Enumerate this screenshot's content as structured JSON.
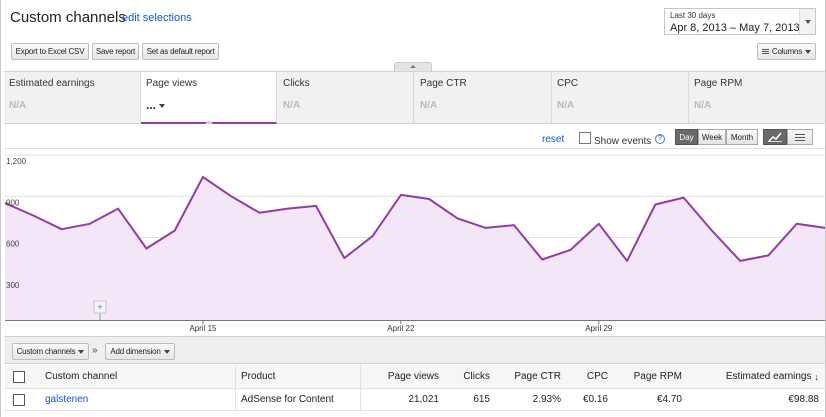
{
  "header": {
    "title": "Custom channels",
    "edit_link": "edit selections",
    "date_range": {
      "label": "Last 30 days",
      "range": "Apr 8, 2013 – May 7, 2013"
    }
  },
  "toolbar": {
    "export_label": "Export to Excel CSV",
    "save_label": "Save report",
    "default_label": "Set as default report",
    "columns_label": "Columns"
  },
  "metrics": [
    {
      "label": "Estimated earnings",
      "value": "N/A"
    },
    {
      "label": "Page views",
      "value": "...",
      "selected": true
    },
    {
      "label": "Clicks",
      "value": "N/A"
    },
    {
      "label": "Page CTR",
      "value": "N/A"
    },
    {
      "label": "CPC",
      "value": "N/A"
    },
    {
      "label": "Page RPM",
      "value": "N/A"
    }
  ],
  "chart_controls": {
    "reset_label": "reset",
    "show_events_label": "Show events",
    "help_icon": "?",
    "granularity": [
      "Day",
      "Week",
      "Month"
    ],
    "active_granularity": "Day",
    "view_icons": [
      "line-chart-icon",
      "table-view-icon"
    ]
  },
  "chart_data": {
    "type": "area",
    "ylim": [
      0,
      1200
    ],
    "yticks": [
      {
        "value": 1200,
        "label": "1,200"
      },
      {
        "value": 900,
        "label": "900"
      },
      {
        "value": 600,
        "label": "600"
      },
      {
        "value": 300,
        "label": "300"
      }
    ],
    "x_labels": [
      {
        "index": 7,
        "label": "April 15"
      },
      {
        "index": 14,
        "label": "April 22"
      },
      {
        "index": 21,
        "label": "April 29"
      }
    ],
    "x_dates": [
      "Apr 8",
      "Apr 9",
      "Apr 10",
      "Apr 11",
      "Apr 12",
      "Apr 13",
      "Apr 14",
      "Apr 15",
      "Apr 16",
      "Apr 17",
      "Apr 18",
      "Apr 19",
      "Apr 20",
      "Apr 21",
      "Apr 22",
      "Apr 23",
      "Apr 24",
      "Apr 25",
      "Apr 26",
      "Apr 27",
      "Apr 28",
      "Apr 29",
      "Apr 30",
      "May 1",
      "May 2",
      "May 3",
      "May 4",
      "May 5",
      "May 6",
      "May 7"
    ],
    "values": [
      850,
      760,
      660,
      700,
      810,
      520,
      650,
      1040,
      900,
      780,
      810,
      830,
      450,
      610,
      910,
      880,
      740,
      670,
      690,
      440,
      510,
      700,
      430,
      840,
      890,
      650,
      430,
      470,
      700,
      670
    ],
    "line_color": "#8e3ea4",
    "fill_color": "#f3e6f6",
    "event_marker": "+"
  },
  "dimensions": {
    "primary_label": "Custom channels",
    "separator": "»",
    "add_label": "Add dimension"
  },
  "table": {
    "columns": [
      "Custom channel",
      "Product",
      "Page views",
      "Clicks",
      "Page CTR",
      "CPC",
      "Page RPM",
      "Estimated earnings"
    ],
    "sort_indicator": "↓",
    "rows": [
      {
        "channel": "galstenen",
        "product": "AdSense for Content",
        "page_views": "21,021",
        "clicks": "615",
        "page_ctr": "2.93%",
        "cpc": "€0.16",
        "page_rpm": "€4.70",
        "earnings": "€98.88"
      }
    ]
  }
}
